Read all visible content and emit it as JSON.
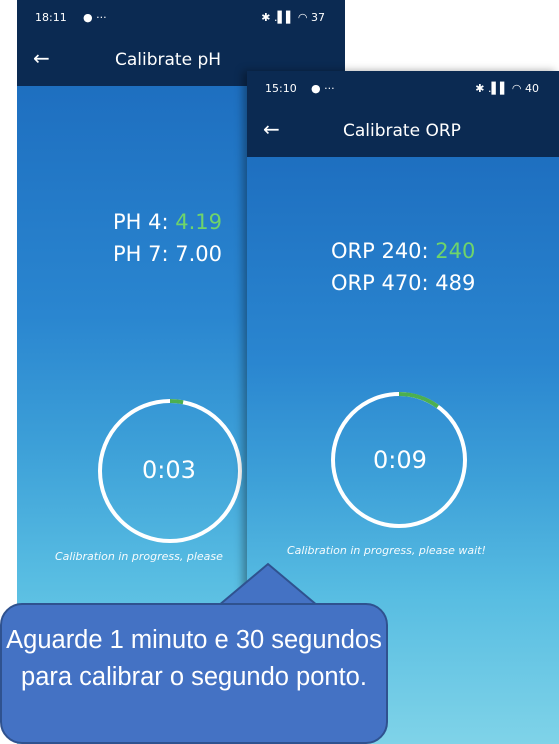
{
  "ph_screen": {
    "status_time": "18:11",
    "status_extras": "● ···",
    "status_icons": "✱ .▌▌ ◠ 37",
    "back_icon": "←",
    "title": "Calibrate pH",
    "reading_1_label": "PH 4: ",
    "reading_1_value": "4.19",
    "reading_2_label": "PH 7: ",
    "reading_2_value": "7.00",
    "timer": "0:03",
    "progress": 0.03,
    "status_message": "Calibration in progress, please"
  },
  "orp_screen": {
    "status_time": "15:10",
    "status_extras": "● ···",
    "status_icons": "✱ .▌▌ ◠ 40",
    "back_icon": "←",
    "title": "Calibrate ORP",
    "reading_1_label": "ORP 240: ",
    "reading_1_value": "240",
    "reading_2_label": "ORP 470: ",
    "reading_2_value": "489",
    "timer": "0:09",
    "progress": 0.1,
    "status_message": "Calibration in progress, please wait!"
  },
  "callout": {
    "text": "Aguarde 1 minuto e 30 segundos para calibrar o segundo ponto."
  },
  "colors": {
    "header": "#0b2a52",
    "good_value": "#6fd46a",
    "progress_arc": "#4caf50",
    "callout_fill": "#4472c4"
  }
}
